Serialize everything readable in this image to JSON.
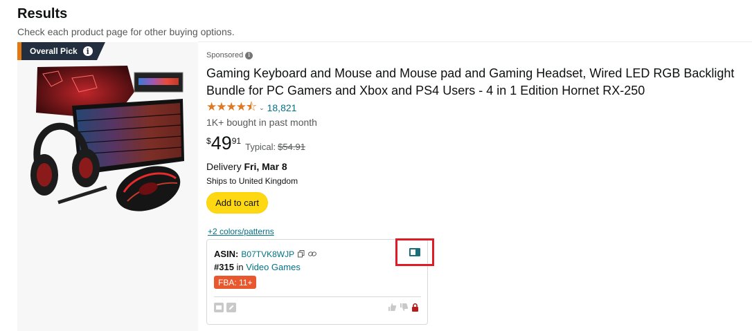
{
  "header": {
    "title": "Results",
    "subtitle": "Check each product page for other buying options."
  },
  "badge": {
    "label": "Overall Pick",
    "info_glyph": "i"
  },
  "product": {
    "sponsored_label": "Sponsored",
    "title": "Gaming Keyboard and Mouse and Mouse pad and Gaming Headset, Wired LED RGB Backlight Bundle for PC Gamers and Xbox and PS4 Users - 4 in 1 Edition Hornet RX-250",
    "stars_glyph": "★★★★⯪",
    "rating_count": "18,821",
    "bought": "1K+ bought in past month",
    "price": {
      "symbol": "$",
      "whole": "49",
      "fraction": "91"
    },
    "typical_label": "Typical:",
    "typical_price": "$54.91",
    "delivery_label": "Delivery",
    "delivery_date": "Fri, Mar 8",
    "ships_to": "Ships to United Kingdom",
    "add_to_cart": "Add to cart",
    "colors_link": "+2 colors/patterns"
  },
  "extension": {
    "asin_label": "ASIN:",
    "asin_value": "B07TVK8WJP",
    "rank_value": "#315",
    "rank_in": "in",
    "rank_category": "Video Games",
    "fba_badge": "FBA: 11+"
  },
  "colors": {
    "accent_orange": "#de7921",
    "link": "#007185",
    "cart_button": "#ffd814",
    "fba_badge": "#e8572e",
    "highlight_box": "#e01b24"
  }
}
